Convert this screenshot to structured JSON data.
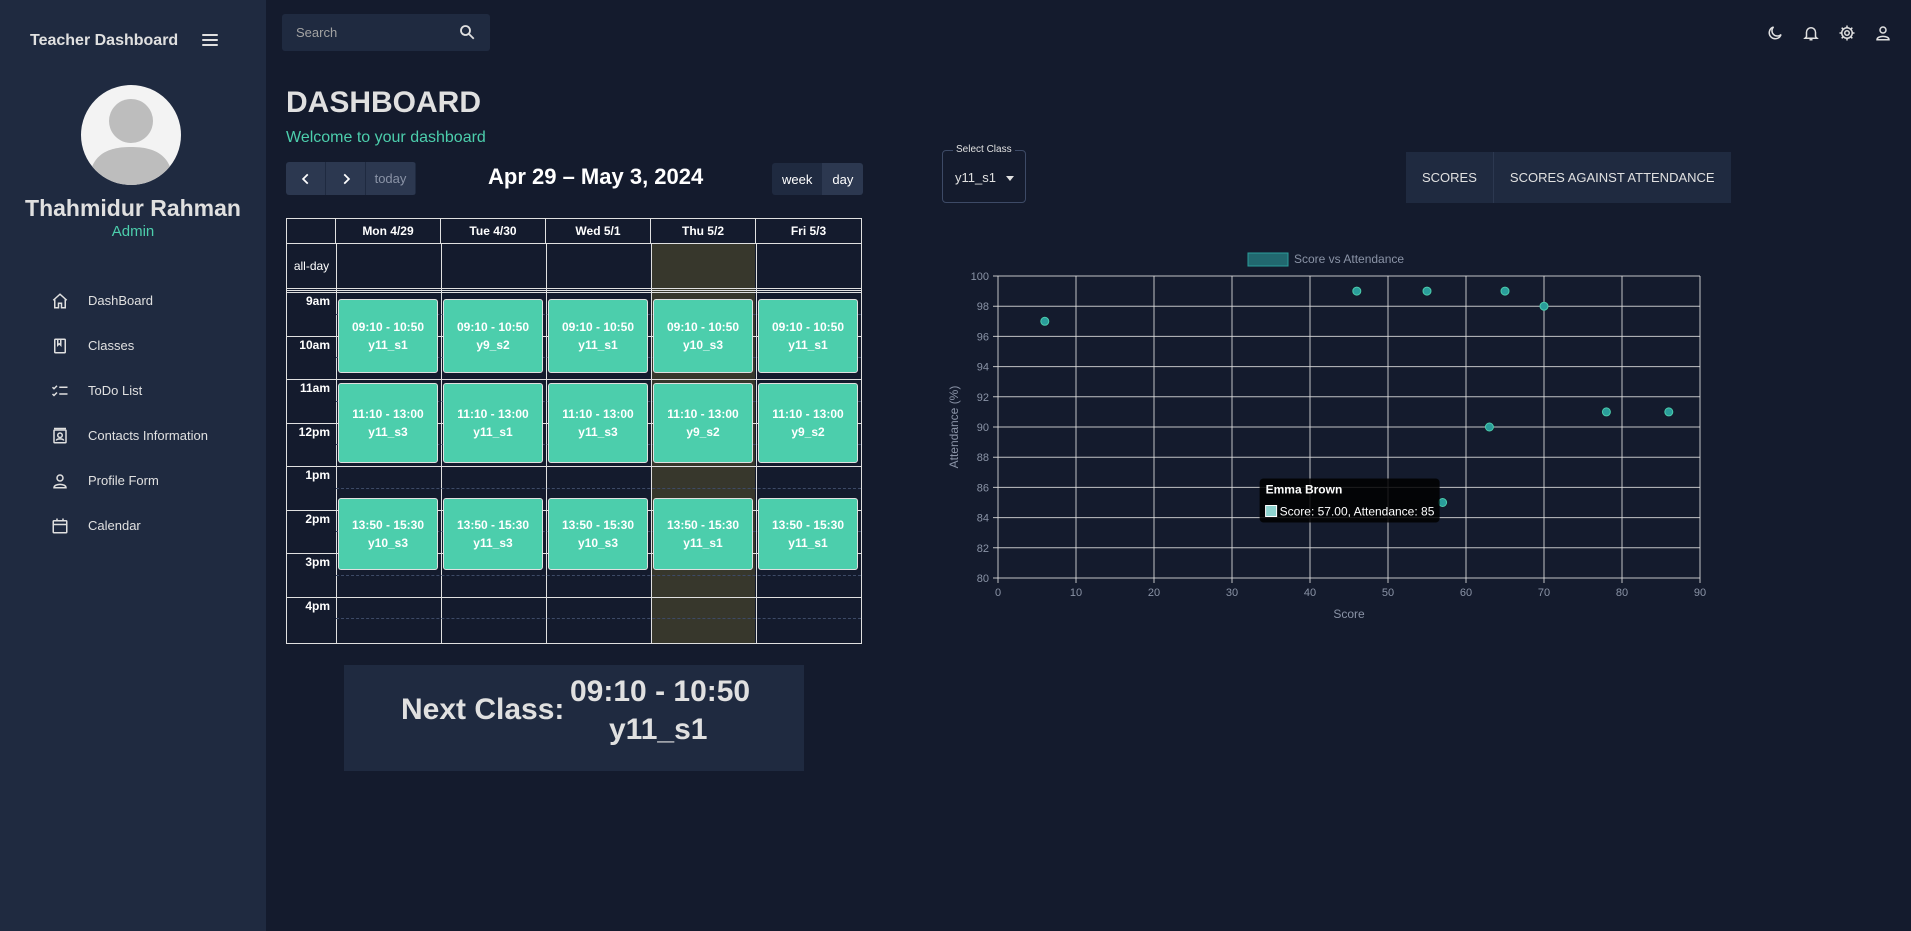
{
  "sidebar": {
    "title": "Teacher Dashboard",
    "user_name": "Thahmidur Rahman",
    "user_role": "Admin",
    "items": [
      {
        "label": "DashBoard",
        "icon": "home-icon"
      },
      {
        "label": "Classes",
        "icon": "book-icon"
      },
      {
        "label": "ToDo List",
        "icon": "checklist-icon"
      },
      {
        "label": "Contacts Information",
        "icon": "contact-card-icon"
      },
      {
        "label": "Profile Form",
        "icon": "person-icon"
      },
      {
        "label": "Calendar",
        "icon": "calendar-icon"
      }
    ]
  },
  "search": {
    "placeholder": "Search",
    "value": ""
  },
  "header": {
    "title": "DASHBOARD",
    "subtitle": "Welcome to your dashboard"
  },
  "top_icons": [
    "moon-icon",
    "bell-icon",
    "gear-icon",
    "person-icon"
  ],
  "calendar": {
    "today_label": "today",
    "range_title": "Apr 29 – May 3, 2024",
    "view_week": "week",
    "view_day": "day",
    "allday_label": "all-day",
    "days": [
      "Mon 4/29",
      "Tue 4/30",
      "Wed 5/1",
      "Thu 5/2",
      "Fri 5/3"
    ],
    "hours": [
      "9am",
      "10am",
      "11am",
      "12pm",
      "1pm",
      "2pm",
      "3pm",
      "4pm"
    ],
    "events": [
      {
        "day": 0,
        "slot": "morning",
        "time": "09:10 - 10:50",
        "cls": "y11_s1"
      },
      {
        "day": 1,
        "slot": "morning",
        "time": "09:10 - 10:50",
        "cls": "y9_s2"
      },
      {
        "day": 2,
        "slot": "morning",
        "time": "09:10 - 10:50",
        "cls": "y11_s1"
      },
      {
        "day": 3,
        "slot": "morning",
        "time": "09:10 - 10:50",
        "cls": "y10_s3"
      },
      {
        "day": 4,
        "slot": "morning",
        "time": "09:10 - 10:50",
        "cls": "y11_s1"
      },
      {
        "day": 0,
        "slot": "midday",
        "time": "11:10 - 13:00",
        "cls": "y11_s3"
      },
      {
        "day": 1,
        "slot": "midday",
        "time": "11:10 - 13:00",
        "cls": "y11_s1"
      },
      {
        "day": 2,
        "slot": "midday",
        "time": "11:10 - 13:00",
        "cls": "y11_s3"
      },
      {
        "day": 3,
        "slot": "midday",
        "time": "11:10 - 13:00",
        "cls": "y9_s2"
      },
      {
        "day": 4,
        "slot": "midday",
        "time": "11:10 - 13:00",
        "cls": "y9_s2"
      },
      {
        "day": 0,
        "slot": "afternoon",
        "time": "13:50 - 15:30",
        "cls": "y10_s3"
      },
      {
        "day": 1,
        "slot": "afternoon",
        "time": "13:50 - 15:30",
        "cls": "y11_s3"
      },
      {
        "day": 2,
        "slot": "afternoon",
        "time": "13:50 - 15:30",
        "cls": "y10_s3"
      },
      {
        "day": 3,
        "slot": "afternoon",
        "time": "13:50 - 15:30",
        "cls": "y11_s1"
      },
      {
        "day": 4,
        "slot": "afternoon",
        "time": "13:50 - 15:30",
        "cls": "y11_s1"
      }
    ]
  },
  "next_class": {
    "label": "Next Class:",
    "time": "09:10 - 10:50",
    "cls": "y11_s1"
  },
  "select_class": {
    "label": "Select Class",
    "value": "y11_s1"
  },
  "tabs": [
    "SCORES",
    "SCORES AGAINST ATTENDANCE"
  ],
  "colors": {
    "accent": "#4cceac",
    "background": "#141b2d",
    "panel": "#1f2a40",
    "point": "#2a9d9b"
  },
  "chart_data": {
    "type": "scatter",
    "legend": "Score vs Attendance",
    "xlabel": "Score",
    "ylabel": "Attendance (%)",
    "xlim": [
      0,
      90
    ],
    "ylim": [
      80,
      100
    ],
    "xticks": [
      0,
      10,
      20,
      30,
      40,
      50,
      60,
      70,
      80,
      90
    ],
    "yticks": [
      80,
      82,
      84,
      86,
      88,
      90,
      92,
      94,
      96,
      98,
      100
    ],
    "grid": true,
    "legend_position": "top-center",
    "series": [
      {
        "name": "Score vs Attendance",
        "points": [
          {
            "x": 6,
            "y": 97
          },
          {
            "x": 46,
            "y": 99
          },
          {
            "x": 55,
            "y": 99
          },
          {
            "x": 65,
            "y": 99
          },
          {
            "x": 70,
            "y": 98
          },
          {
            "x": 63,
            "y": 90
          },
          {
            "x": 78,
            "y": 91
          },
          {
            "x": 86,
            "y": 91
          },
          {
            "x": 57,
            "y": 85
          }
        ]
      }
    ],
    "tooltip": {
      "title": "Emma Brown",
      "text": "Score: 57.00, Attendance: 85",
      "point_index": 8
    }
  }
}
